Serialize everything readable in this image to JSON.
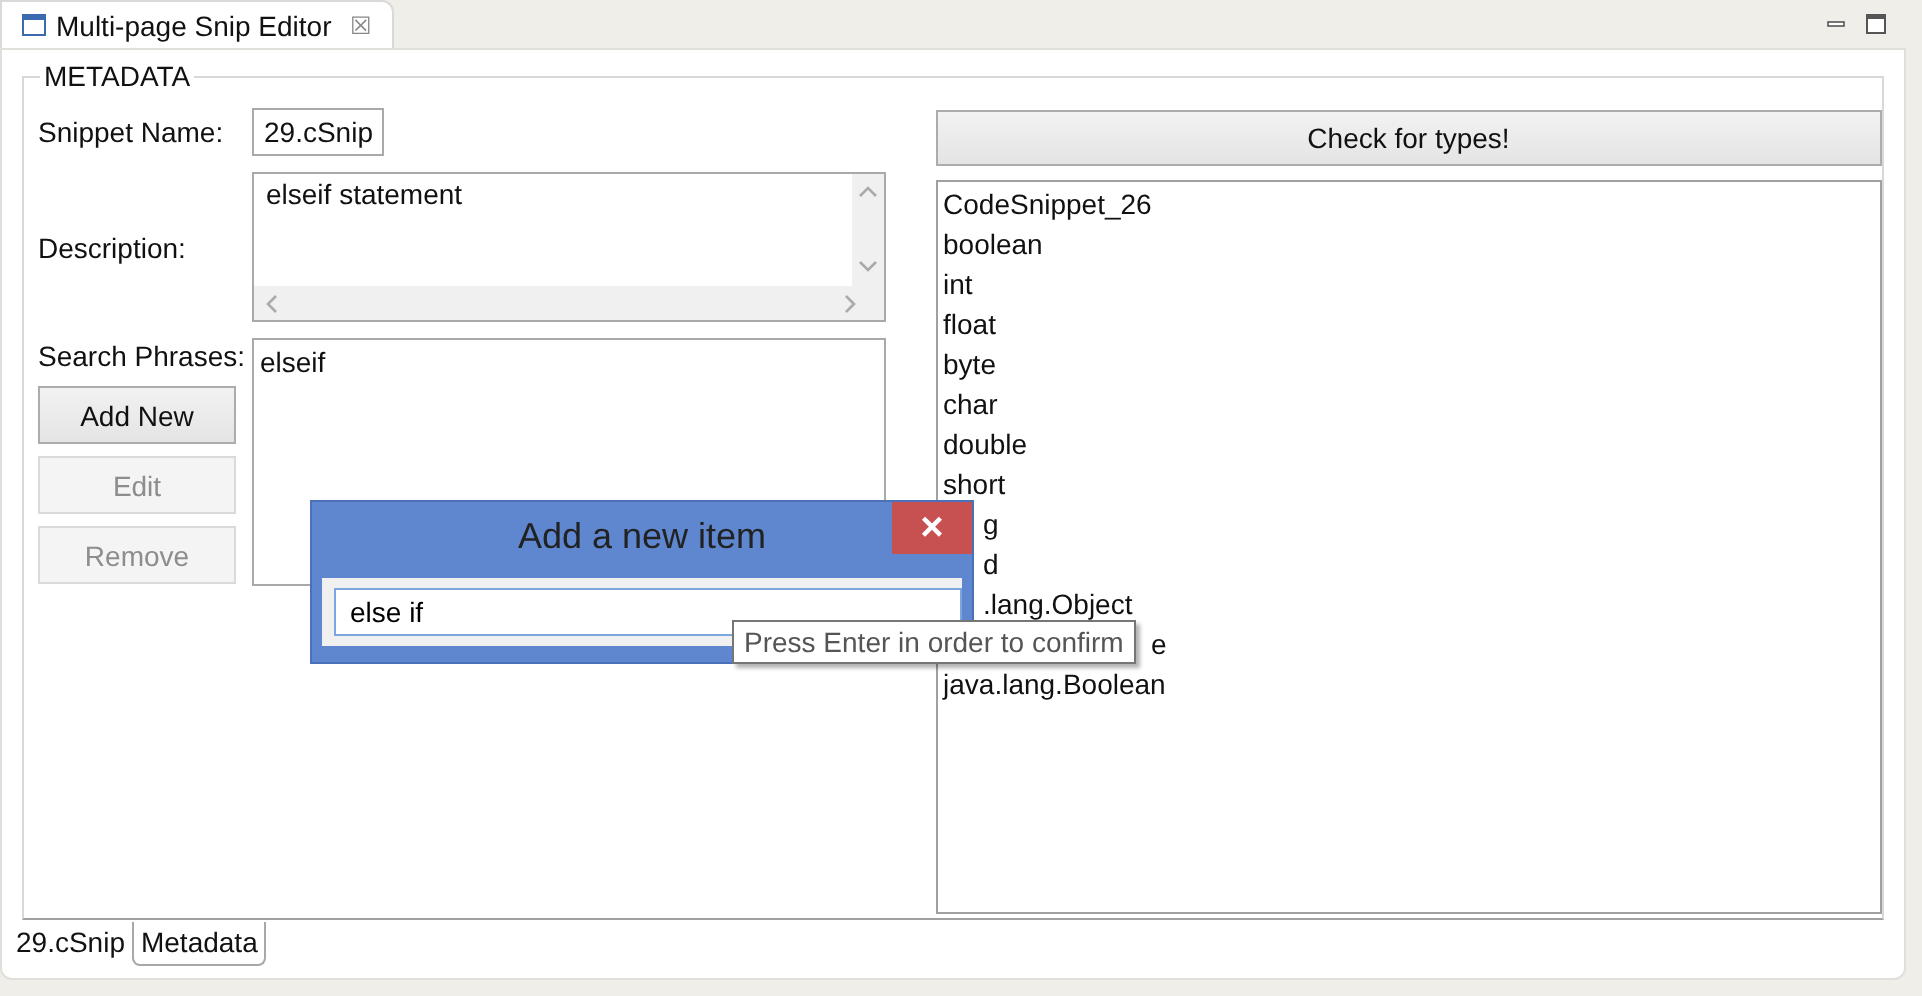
{
  "editor_tab": {
    "title": "Multi-page Snip Editor",
    "close": "☒"
  },
  "group": {
    "title": "METADATA"
  },
  "snippet_name": {
    "label": "Snippet Name:",
    "value": "29.cSnip"
  },
  "description": {
    "label": "Description:",
    "value": "elseif statement"
  },
  "search_phrases": {
    "label": "Search Phrases:",
    "items": [
      "elseif"
    ]
  },
  "buttons": [
    {
      "label": "Add New",
      "disabled": false
    },
    {
      "label": "Edit",
      "disabled": true
    },
    {
      "label": "Remove",
      "disabled": true
    }
  ],
  "check_button": {
    "label": "Check for types!"
  },
  "types_list": [
    {
      "text": "CodeSnippet_26",
      "kind": "full"
    },
    {
      "text": "boolean",
      "kind": "full"
    },
    {
      "text": "int",
      "kind": "full"
    },
    {
      "text": "float",
      "kind": "full"
    },
    {
      "text": "byte",
      "kind": "full"
    },
    {
      "text": "char",
      "kind": "full"
    },
    {
      "text": "double",
      "kind": "full"
    },
    {
      "text": "short",
      "kind": "full"
    },
    {
      "text": "g",
      "kind": "under-dialog"
    },
    {
      "text": "d",
      "kind": "under-dialog"
    },
    {
      "text": ".lang.Object",
      "kind": "under-dialog"
    },
    {
      "text": "e",
      "kind": "under-tooltip"
    },
    {
      "text": "java.lang.Boolean",
      "kind": "full"
    }
  ],
  "dialog": {
    "title": "Add a new item",
    "close": "×",
    "value": "else if"
  },
  "tooltip": {
    "text": "Press Enter in order to confirm"
  },
  "bottom_tabs": [
    {
      "label": "29.cSnip",
      "selected": false
    },
    {
      "label": "Metadata",
      "selected": true
    }
  ]
}
